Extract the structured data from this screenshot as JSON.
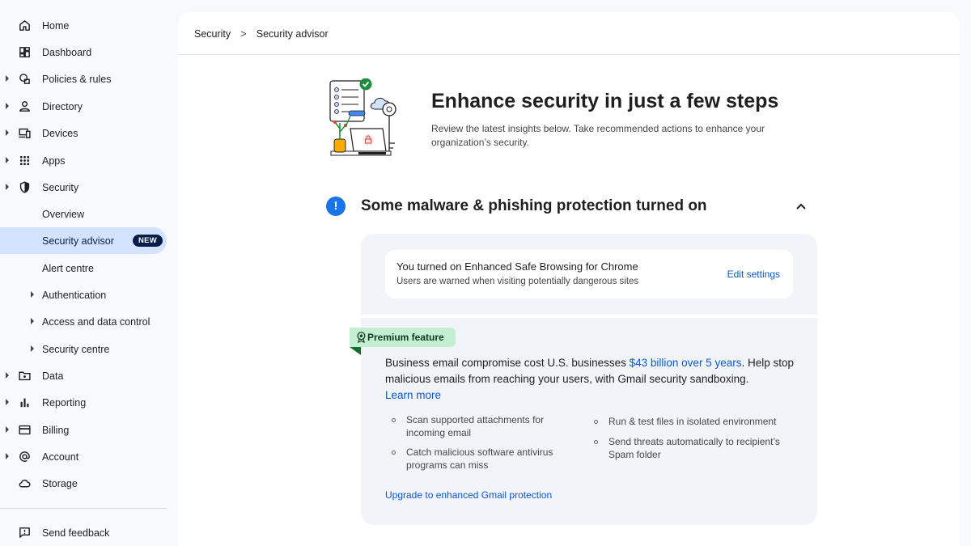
{
  "sidebar": {
    "items": [
      {
        "label": "Home",
        "icon": "home-icon",
        "has_caret": false
      },
      {
        "label": "Dashboard",
        "icon": "dashboard-icon",
        "has_caret": false
      },
      {
        "label": "Policies & rules",
        "icon": "policies-icon",
        "has_caret": true
      },
      {
        "label": "Directory",
        "icon": "person-icon",
        "has_caret": true
      },
      {
        "label": "Devices",
        "icon": "devices-icon",
        "has_caret": true
      },
      {
        "label": "Apps",
        "icon": "apps-grid-icon",
        "has_caret": true
      },
      {
        "label": "Security",
        "icon": "shield-icon",
        "has_caret": true
      },
      {
        "label": "Overview",
        "icon": "",
        "has_caret": false
      },
      {
        "label": "Security advisor",
        "icon": "",
        "has_caret": false,
        "badge": "NEW",
        "active": true
      },
      {
        "label": "Alert centre",
        "icon": "",
        "has_caret": false
      },
      {
        "label": "Authentication",
        "icon": "",
        "has_caret": true
      },
      {
        "label": "Access and data control",
        "icon": "",
        "has_caret": true
      },
      {
        "label": "Security centre",
        "icon": "",
        "has_caret": true
      },
      {
        "label": "Data",
        "icon": "data-folder-icon",
        "has_caret": true
      },
      {
        "label": "Reporting",
        "icon": "bar-chart-icon",
        "has_caret": true
      },
      {
        "label": "Billing",
        "icon": "credit-card-icon",
        "has_caret": true
      },
      {
        "label": "Account",
        "icon": "at-sign-icon",
        "has_caret": true
      },
      {
        "label": "Storage",
        "icon": "cloud-icon",
        "has_caret": false
      }
    ],
    "feedback": "Send feedback"
  },
  "breadcrumb": {
    "parent": "Security",
    "separator": ">",
    "current": "Security advisor"
  },
  "hero": {
    "title": "Enhance security in just a few steps",
    "description": "Review the latest insights below. Take recommended actions to enhance your organization’s security."
  },
  "section": {
    "icon": "!",
    "title": "Some malware & phishing protection turned on",
    "status_color": "#1a73e8"
  },
  "setting_card": {
    "title": "You turned on Enhanced Safe Browsing for Chrome",
    "subtitle": "Users are warned when visiting potentially dangerous sites",
    "action": "Edit settings"
  },
  "premium": {
    "badge": "Premium feature",
    "text_before": "Business email compromise cost U.S. businesses ",
    "highlight": "$43 billion over 5 years",
    "text_after": ".  Help stop malicious emails from reaching your users, with Gmail security sandboxing.",
    "learn_more": "Learn more",
    "bullets_left": [
      "Scan supported attachments for incoming email",
      "Catch malicious software antivirus programs can miss"
    ],
    "bullets_right": [
      "Run & test files in isolated environment",
      "Send threats automatically to recipient’s Spam folder"
    ],
    "upgrade_link": "Upgrade to enhanced Gmail protection"
  },
  "colors": {
    "accent": "#0b57d0",
    "active_nav": "#d3e3fd",
    "premium_badge": "#c4eed0"
  }
}
